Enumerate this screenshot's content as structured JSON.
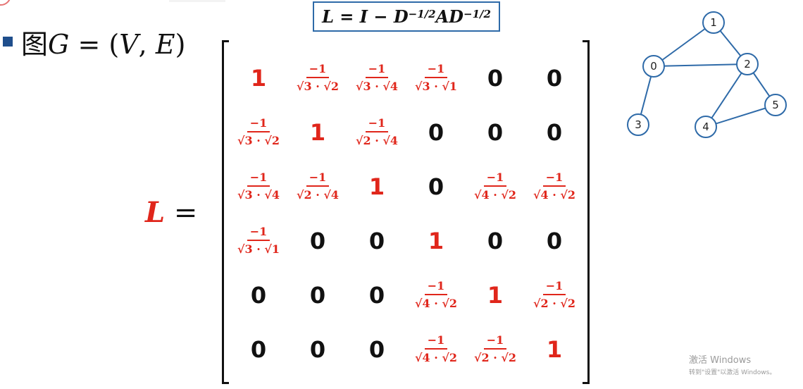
{
  "heading": {
    "han": "图",
    "G": "G",
    "eq": " = (",
    "V": "V",
    "comma": ", ",
    "E": "E",
    "close": ")"
  },
  "formula": {
    "lhs": "L = I − D",
    "exp1": "−1/2",
    "mid": "AD",
    "exp2": "−1/2"
  },
  "lhs": {
    "L": "L",
    "eq": " ="
  },
  "matrix": [
    [
      "1",
      {
        "num": "−1",
        "den": "√3 · √2"
      },
      {
        "num": "−1",
        "den": "√3 · √4"
      },
      {
        "num": "−1",
        "den": "√3 · √1"
      },
      "0",
      "0"
    ],
    [
      {
        "num": "−1",
        "den": "√3 · √2"
      },
      "1",
      {
        "num": "−1",
        "den": "√2 · √4"
      },
      "0",
      "0",
      "0"
    ],
    [
      {
        "num": "−1",
        "den": "√3 · √4"
      },
      {
        "num": "−1",
        "den": "√2 · √4"
      },
      "1",
      "0",
      {
        "num": "−1",
        "den": "√4 · √2"
      },
      {
        "num": "−1",
        "den": "√4 · √2"
      }
    ],
    [
      {
        "num": "−1",
        "den": "√3 · √1"
      },
      "0",
      "0",
      "1",
      "0",
      "0"
    ],
    [
      "0",
      "0",
      "0",
      {
        "num": "−1",
        "den": "√4 · √2"
      },
      "1",
      {
        "num": "−1",
        "den": "√2 · √2"
      }
    ],
    [
      "0",
      "0",
      "0",
      {
        "num": "−1",
        "den": "√4 · √2"
      },
      {
        "num": "−1",
        "den": "√2 · √2"
      },
      "1"
    ]
  ],
  "graph": {
    "nodes": [
      "0",
      "1",
      "2",
      "3",
      "4",
      "5"
    ],
    "edges": [
      [
        "0",
        "1"
      ],
      [
        "0",
        "2"
      ],
      [
        "1",
        "2"
      ],
      [
        "0",
        "3"
      ],
      [
        "2",
        "4"
      ],
      [
        "2",
        "5"
      ],
      [
        "4",
        "5"
      ]
    ]
  },
  "watermark": {
    "line1": "激活 Windows",
    "line2": "转到\"设置\"以激活 Windows。"
  },
  "colors": {
    "accent_red": "#e0261b",
    "accent_blue": "#2e6aa8",
    "bullet": "#1f4e8c"
  }
}
